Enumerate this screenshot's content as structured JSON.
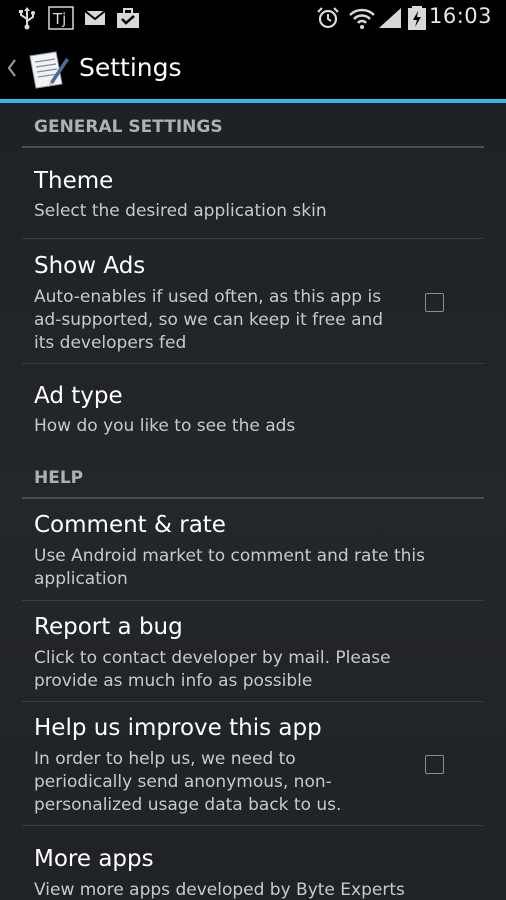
{
  "status_bar": {
    "time": "16:03",
    "icons": [
      "usb-icon",
      "tj-app-icon",
      "gmail-icon",
      "briefcase-icon",
      "alarm-icon",
      "wifi-icon",
      "signal-icon",
      "battery-charging-icon"
    ]
  },
  "action_bar": {
    "title": "Settings"
  },
  "sections": {
    "general": {
      "header": "GENERAL SETTINGS",
      "theme": {
        "title": "Theme",
        "summary": "Select the desired application skin"
      },
      "show_ads": {
        "title": "Show Ads",
        "summary_lines": [
          "Auto-enables if used often, as this app is",
          "ad-supported, so we can keep it free and",
          "its developers fed"
        ],
        "checked": false
      },
      "ad_type": {
        "title": "Ad type",
        "summary": "How do you like to see the ads"
      }
    },
    "help": {
      "header": "HELP",
      "comment_rate": {
        "title": "Comment & rate",
        "summary_lines": [
          "Use Android market to comment and rate this",
          "application"
        ]
      },
      "report_bug": {
        "title": "Report a bug",
        "summary_lines": [
          "Click to contact developer by mail. Please",
          "provide as much info as possible"
        ]
      },
      "improve": {
        "title": "Help us improve this app",
        "summary_lines": [
          "In order to help us, we need to",
          "periodically send anonymous, non-",
          "personalized usage data back to us."
        ],
        "checked": false
      },
      "more_apps": {
        "title": "More apps",
        "summary": "View more apps developed by Byte Experts"
      }
    }
  },
  "colors": {
    "accent": "#33b5e5",
    "background": "#1f2227",
    "section_header": "#aeb0b3"
  }
}
